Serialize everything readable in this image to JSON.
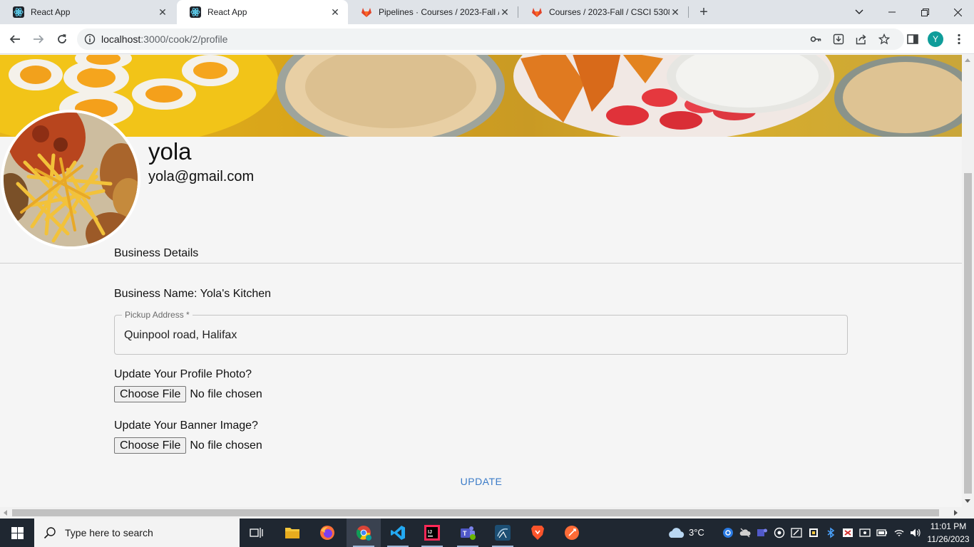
{
  "browser": {
    "tabs": [
      {
        "title": "React App",
        "active": false,
        "icon": "react-icon"
      },
      {
        "title": "React App",
        "active": true,
        "icon": "react-icon"
      },
      {
        "title": "Pipelines · Courses / 2023-Fall / C",
        "active": false,
        "icon": "gitlab-icon"
      },
      {
        "title": "Courses / 2023-Fall / CSCI 5308",
        "active": false,
        "icon": "gitlab-icon"
      }
    ],
    "url_host": "localhost",
    "url_path": ":3000/cook/2/profile",
    "profile_initial": "Y"
  },
  "profile": {
    "name": "yola",
    "email": "yola@gmail.com"
  },
  "business": {
    "section_title": "Business Details",
    "name_label": "Business Name: Yola's Kitchen",
    "address_legend": "Pickup Address *",
    "address_value": "Quinpool road, Halifax"
  },
  "uploads": {
    "profile_photo_label": "Update Your Profile Photo?",
    "banner_label": "Update Your Banner Image?",
    "choose_file": "Choose File",
    "no_file": "No file chosen"
  },
  "actions": {
    "update": "UPDATE"
  },
  "taskbar": {
    "search_placeholder": "Type here to search",
    "temperature": "3°C",
    "time": "11:01 PM",
    "date": "11/26/2023"
  },
  "colors": {
    "accent_blue": "#3a7bc8",
    "taskbar_bg": "#1f2731",
    "avatar_teal": "#0f9d9a"
  }
}
